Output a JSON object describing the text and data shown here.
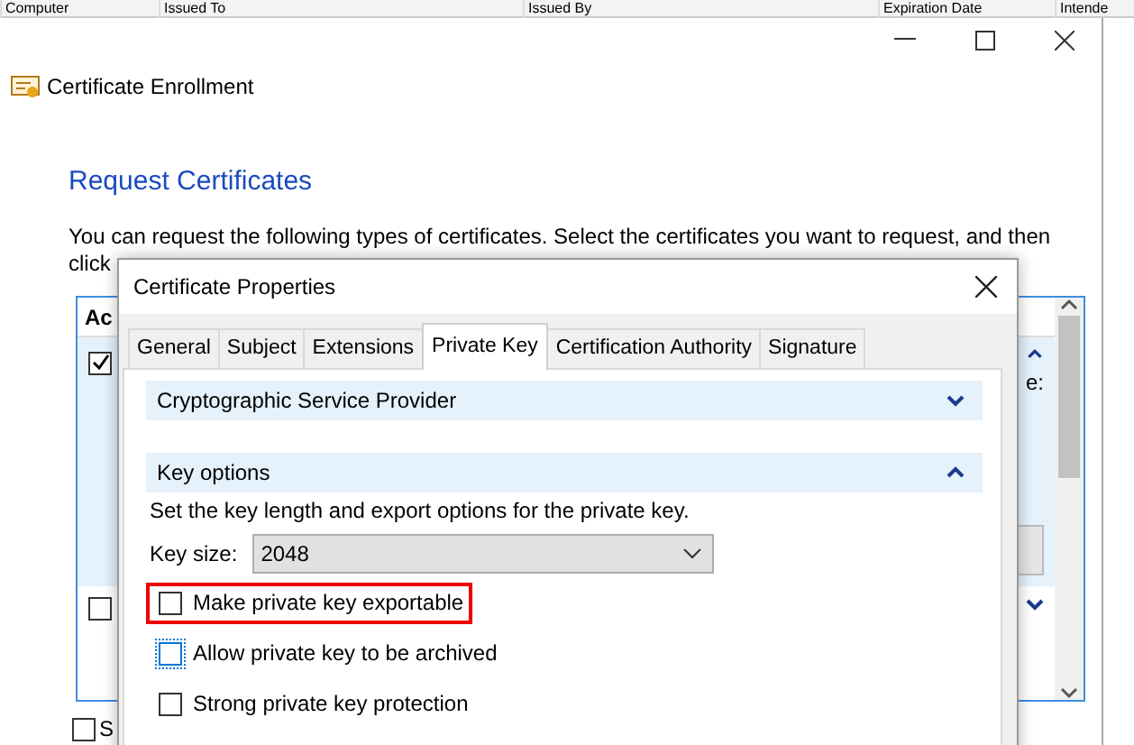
{
  "background_list": {
    "columns": [
      "Computer",
      "Issued To",
      "Issued By",
      "Expiration Date",
      "Intende"
    ]
  },
  "window": {
    "title": "Certificate Enrollment",
    "heading": "Request Certificates",
    "intro": [
      "You can request the following types of certificates. Select the certificates you want to request, and then",
      "click"
    ]
  },
  "certificate_list": {
    "header": "Ac",
    "rows": [
      {
        "checked": true,
        "selected": true,
        "side_text": "e:"
      },
      {
        "checked": false,
        "selected": false
      }
    ]
  },
  "bottom_option": {
    "label": "S",
    "checked": false
  },
  "dialog": {
    "title": "Certificate Properties",
    "tabs": [
      {
        "label": "General",
        "selected": false
      },
      {
        "label": "Subject",
        "selected": false
      },
      {
        "label": "Extensions",
        "selected": false
      },
      {
        "label": "Private Key",
        "selected": true
      },
      {
        "label": "Certification Authority",
        "selected": false
      },
      {
        "label": "Signature",
        "selected": false
      }
    ],
    "sections": [
      {
        "title": "Cryptographic Service Provider",
        "expanded": false
      },
      {
        "title": "Key options",
        "expanded": true,
        "description": "Set the key length and export options for the private key.",
        "key_size": {
          "label": "Key size:",
          "value": "2048"
        },
        "options": [
          {
            "label": "Make private key exportable",
            "checked": false,
            "focused": false,
            "highlighted": true
          },
          {
            "label": "Allow private key to be archived",
            "checked": false,
            "focused": true,
            "highlighted": false
          },
          {
            "label": "Strong private key protection",
            "checked": false,
            "focused": false,
            "highlighted": false
          }
        ]
      }
    ]
  }
}
